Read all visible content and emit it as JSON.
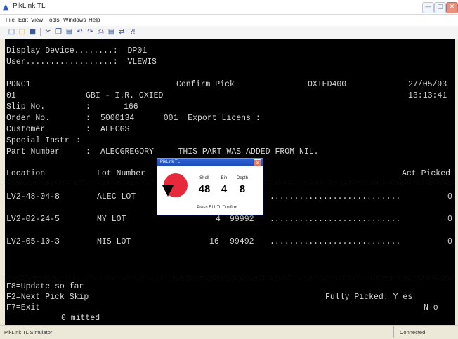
{
  "window": {
    "title": "PikLink TL",
    "icon": "scanner-icon"
  },
  "menu": [
    "File",
    "Edit",
    "View",
    "Tools",
    "Windows",
    "Help"
  ],
  "toolbar": [
    "new",
    "open",
    "save",
    "cut",
    "copy",
    "paste",
    "undo",
    "redo",
    "print",
    "preview",
    "connect",
    "help"
  ],
  "terminal": {
    "lines": [
      "Display Device........:  DP01",
      "User..................:  VLEWIS"
    ],
    "header": {
      "program": "PDNC1",
      "title": "Confirm Pick",
      "terminal_id": "OXIED400",
      "date": "27/05/93",
      "company_no": "01",
      "company": "GBI - I.R. OXIED",
      "time": "13:13:41"
    },
    "fields": [
      {
        "label": "Slip No.",
        "sep": ":",
        "value": "166"
      },
      {
        "label": "Order No.",
        "sep": ":",
        "value": "5000134      001  Export Licens :"
      },
      {
        "label": "Customer",
        "sep": ":",
        "value": "ALECGS"
      },
      {
        "label": "Special Instr",
        "sep": ":",
        "value": ""
      },
      {
        "label": "Part Number",
        "sep": ":",
        "value": "ALECGREGORY     THIS PART WAS ADDED FROM NIL."
      }
    ],
    "columns": {
      "location": "Location",
      "lot": "Lot Number",
      "picked": "Act Picked"
    },
    "rows": [
      {
        "location": "LV2-48-04-8",
        "lot": "ALEC LOT",
        "qty": "",
        "bin": "",
        "dots": "...........................",
        "picked": "0"
      },
      {
        "location": "LV2-02-24-5",
        "lot": "MY LOT",
        "qty": "4",
        "bin": "99992",
        "dots": "...........................",
        "picked": "0"
      },
      {
        "location": "LV2-05-10-3",
        "lot": "MIS LOT",
        "qty": "16",
        "bin": "99492",
        "dots": "...........................",
        "picked": "0"
      }
    ],
    "footer": {
      "f8": "F8=Update so far",
      "f2": "F2=Next Pick Skip",
      "f7": "F7=Exit",
      "omitted": "0 mitted",
      "fully_picked_label": "Fully Picked: Y es",
      "fully_picked_no": "N o"
    }
  },
  "popup": {
    "title": "PikLink TL",
    "labels": {
      "shelf": "Shelf",
      "bin": "Bin",
      "depth": "Depth"
    },
    "values": {
      "shelf": "48",
      "bin": "4",
      "depth": "8"
    },
    "footer": "Press F11 To Confirm",
    "accent": "#e8283b"
  },
  "statusbar": {
    "left": "PikLink TL Simulator",
    "right": "Connected"
  },
  "colors": {
    "terminal_bg": "#000000",
    "terminal_text": "#d6d6d6",
    "titlebar_accent": "#1c48b8"
  }
}
